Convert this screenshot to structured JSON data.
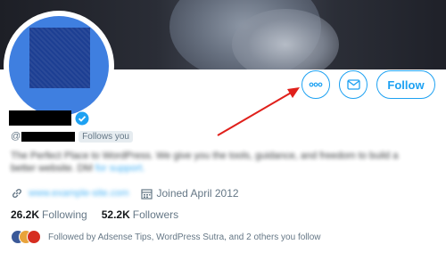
{
  "header": {
    "more_icon": "more-dots-icon",
    "mail_icon": "mail-icon",
    "follow_label": "Follow"
  },
  "profile": {
    "handle_prefix": "@",
    "follows_you": "Follows you",
    "bio_text": "The Perfect Place to WordPress. We give you the tools, guidance, and freedom to build a better website. DM",
    "bio_link": "for support.",
    "joined": "Joined April 2012",
    "link_icon": "link-icon",
    "calendar_icon": "calendar-icon",
    "verified_icon": "verified-badge-icon"
  },
  "stats": {
    "following_count": "26.2K",
    "following_label": "Following",
    "followers_count": "52.2K",
    "followers_label": "Followers"
  },
  "followed_by": {
    "text": "Followed by Adsense Tips, WordPress Sutra, and 2 others you follow"
  },
  "colors": {
    "accent": "#1da1f2",
    "annotation_arrow": "#e0201b",
    "avatar_bg": "#3f7fe0"
  }
}
